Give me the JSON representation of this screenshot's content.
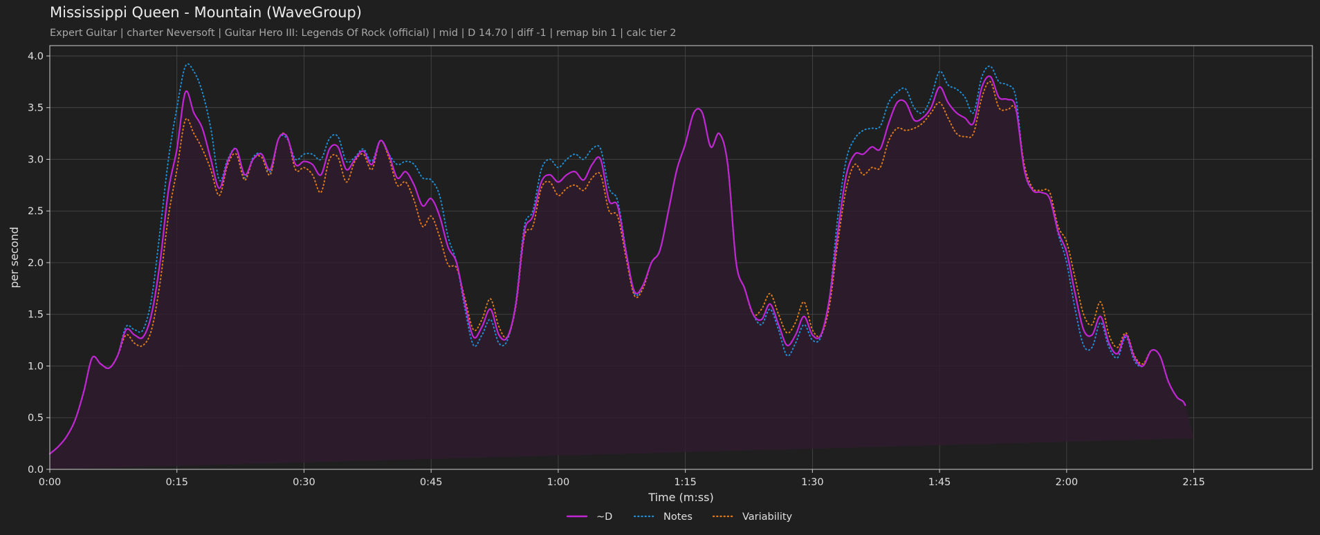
{
  "header": {
    "title": "Mississippi Queen - Mountain (WaveGroup)",
    "subtitle": "Expert Guitar  |  charter Neversoft  |  Guitar Hero III: Legends Of Rock (official)  |  mid  |  D 14.70  |  diff -1  |  remap bin 1  |  calc tier 2"
  },
  "colors": {
    "background": "#1f1f1f",
    "plot_background": "#1f1f1f",
    "grid": "#5a5a5a",
    "axis": "#cfcfcf",
    "d_line": "#c026d3",
    "d_fill": "#2f1c2e",
    "notes_line": "#1f8fd6",
    "variability_line": "#e07b1a"
  },
  "chart_data": {
    "type": "line",
    "xlabel": "Time (m:ss)",
    "ylabel": "per second",
    "xlim": [
      0,
      149
    ],
    "ylim": [
      0,
      4.1
    ],
    "x_ticks": [
      0,
      15,
      30,
      45,
      60,
      75,
      90,
      105,
      120,
      135
    ],
    "x_tick_labels": [
      "0:00",
      "0:15",
      "0:30",
      "0:45",
      "1:00",
      "1:15",
      "1:30",
      "1:45",
      "2:00",
      "2:15"
    ],
    "y_ticks": [
      0.0,
      0.5,
      1.0,
      1.5,
      2.0,
      2.5,
      3.0,
      3.5,
      4.0
    ],
    "y_tick_labels": [
      "0.0",
      "0.5",
      "1.0",
      "1.5",
      "2.0",
      "2.5",
      "3.0",
      "3.5",
      "4.0"
    ],
    "grid": true,
    "legend_position": "bottom-center",
    "x": [
      0,
      1,
      2,
      3,
      4,
      5,
      6,
      7,
      8,
      9,
      10,
      11,
      12,
      13,
      14,
      15,
      16,
      17,
      18,
      19,
      20,
      21,
      22,
      23,
      24,
      25,
      26,
      27,
      28,
      29,
      30,
      31,
      32,
      33,
      34,
      35,
      36,
      37,
      38,
      39,
      40,
      41,
      42,
      43,
      44,
      45,
      46,
      47,
      48,
      49,
      50,
      51,
      52,
      53,
      54,
      55,
      56,
      57,
      58,
      59,
      60,
      61,
      62,
      63,
      64,
      65,
      66,
      67,
      68,
      69,
      70,
      71,
      72,
      73,
      74,
      75,
      76,
      77,
      78,
      79,
      80,
      81,
      82,
      83,
      84,
      85,
      86,
      87,
      88,
      89,
      90,
      91,
      92,
      93,
      94,
      95,
      96,
      97,
      98,
      99,
      100,
      101,
      102,
      103,
      104,
      105,
      106,
      107,
      108,
      109,
      110,
      111,
      112,
      113,
      114,
      115,
      116,
      117,
      118,
      119,
      120,
      121,
      122,
      123,
      124,
      125,
      126,
      127,
      128,
      129,
      130,
      131,
      132,
      133,
      134,
      135,
      136,
      137,
      138,
      139,
      140,
      141,
      142,
      143,
      144,
      145,
      146,
      147,
      148,
      149
    ],
    "series": [
      {
        "name": "~D",
        "style": "solid",
        "values": [
          0.15,
          0.22,
          0.32,
          0.48,
          0.75,
          1.08,
          1.02,
          0.98,
          1.1,
          1.35,
          1.3,
          1.28,
          1.5,
          2.0,
          2.7,
          3.1,
          3.65,
          3.45,
          3.3,
          3.0,
          2.72,
          2.98,
          3.1,
          2.85,
          3.0,
          3.05,
          2.9,
          3.2,
          3.22,
          2.95,
          2.98,
          2.95,
          2.85,
          3.1,
          3.12,
          2.9,
          3.0,
          3.08,
          2.95,
          3.18,
          3.05,
          2.82,
          2.88,
          2.75,
          2.55,
          2.62,
          2.45,
          2.15,
          2.0,
          1.6,
          1.28,
          1.38,
          1.55,
          1.3,
          1.28,
          1.6,
          2.3,
          2.45,
          2.78,
          2.85,
          2.78,
          2.85,
          2.88,
          2.8,
          2.95,
          3.0,
          2.6,
          2.55,
          2.1,
          1.72,
          1.78,
          2.0,
          2.12,
          2.5,
          2.9,
          3.15,
          3.45,
          3.45,
          3.12,
          3.25,
          2.95,
          2.0,
          1.75,
          1.5,
          1.45,
          1.6,
          1.4,
          1.2,
          1.3,
          1.48,
          1.3,
          1.3,
          1.65,
          2.3,
          2.85,
          3.05,
          3.05,
          3.12,
          3.1,
          3.35,
          3.55,
          3.55,
          3.38,
          3.4,
          3.5,
          3.7,
          3.55,
          3.45,
          3.4,
          3.35,
          3.7,
          3.8,
          3.6,
          3.58,
          3.5,
          2.9,
          2.7,
          2.68,
          2.62,
          2.3,
          2.1,
          1.7,
          1.35,
          1.3,
          1.48,
          1.22,
          1.12,
          1.3,
          1.08,
          1.0,
          1.15,
          1.1,
          0.85,
          0.7,
          0.62,
          0.3
        ],
        "color_key": "d_line"
      },
      {
        "name": "Notes",
        "style": "dotted",
        "values": [
          0.15,
          0.22,
          0.32,
          0.48,
          0.75,
          1.08,
          1.02,
          0.98,
          1.1,
          1.38,
          1.35,
          1.35,
          1.65,
          2.3,
          3.0,
          3.5,
          3.9,
          3.85,
          3.65,
          3.3,
          2.8,
          3.0,
          3.1,
          2.82,
          3.02,
          3.05,
          2.88,
          3.2,
          3.2,
          3.0,
          3.05,
          3.05,
          3.0,
          3.2,
          3.22,
          2.98,
          3.02,
          3.1,
          2.98,
          3.18,
          3.05,
          2.95,
          2.98,
          2.95,
          2.82,
          2.8,
          2.65,
          2.25,
          2.0,
          1.55,
          1.2,
          1.3,
          1.45,
          1.22,
          1.25,
          1.62,
          2.35,
          2.5,
          2.9,
          3.0,
          2.92,
          3.0,
          3.05,
          3.0,
          3.1,
          3.1,
          2.72,
          2.6,
          2.12,
          1.7,
          1.78,
          2.0,
          2.12,
          2.5,
          2.9,
          3.15,
          3.45,
          3.45,
          3.12,
          3.25,
          2.95,
          2.0,
          1.75,
          1.5,
          1.4,
          1.55,
          1.35,
          1.1,
          1.22,
          1.4,
          1.25,
          1.28,
          1.65,
          2.45,
          3.0,
          3.2,
          3.28,
          3.3,
          3.32,
          3.55,
          3.65,
          3.68,
          3.5,
          3.45,
          3.6,
          3.85,
          3.72,
          3.68,
          3.6,
          3.45,
          3.8,
          3.9,
          3.75,
          3.72,
          3.6,
          2.9,
          2.7,
          2.68,
          2.62,
          2.28,
          2.0,
          1.55,
          1.2,
          1.18,
          1.42,
          1.18,
          1.08,
          1.28,
          1.05,
          1.0,
          1.15,
          1.1,
          0.85,
          0.7,
          0.62,
          0.3
        ],
        "color_key": "notes_line"
      },
      {
        "name": "Variability",
        "style": "dotted",
        "values": [
          0.15,
          0.22,
          0.32,
          0.48,
          0.75,
          1.08,
          1.02,
          0.98,
          1.1,
          1.3,
          1.22,
          1.2,
          1.35,
          1.8,
          2.45,
          2.9,
          3.38,
          3.25,
          3.1,
          2.9,
          2.65,
          2.95,
          3.05,
          2.8,
          3.0,
          3.02,
          2.85,
          3.2,
          3.22,
          2.9,
          2.92,
          2.85,
          2.68,
          3.0,
          3.02,
          2.78,
          2.98,
          3.05,
          2.9,
          3.18,
          3.02,
          2.75,
          2.78,
          2.6,
          2.35,
          2.45,
          2.25,
          1.98,
          1.95,
          1.65,
          1.35,
          1.45,
          1.65,
          1.38,
          1.28,
          1.58,
          2.25,
          2.35,
          2.72,
          2.78,
          2.65,
          2.72,
          2.75,
          2.7,
          2.82,
          2.85,
          2.5,
          2.45,
          2.05,
          1.68,
          1.75,
          2.0,
          2.12,
          2.5,
          2.9,
          3.15,
          3.45,
          3.45,
          3.12,
          3.25,
          2.95,
          2.0,
          1.75,
          1.5,
          1.55,
          1.7,
          1.5,
          1.32,
          1.42,
          1.62,
          1.35,
          1.3,
          1.58,
          2.2,
          2.72,
          2.95,
          2.85,
          2.92,
          2.92,
          3.18,
          3.3,
          3.28,
          3.3,
          3.35,
          3.45,
          3.55,
          3.4,
          3.25,
          3.22,
          3.25,
          3.6,
          3.75,
          3.5,
          3.48,
          3.48,
          2.95,
          2.72,
          2.7,
          2.68,
          2.35,
          2.2,
          1.85,
          1.5,
          1.4,
          1.62,
          1.3,
          1.18,
          1.32,
          1.1,
          1.02,
          1.15,
          1.1,
          0.85,
          0.7,
          0.62,
          0.3
        ],
        "color_key": "variability_line"
      }
    ]
  }
}
